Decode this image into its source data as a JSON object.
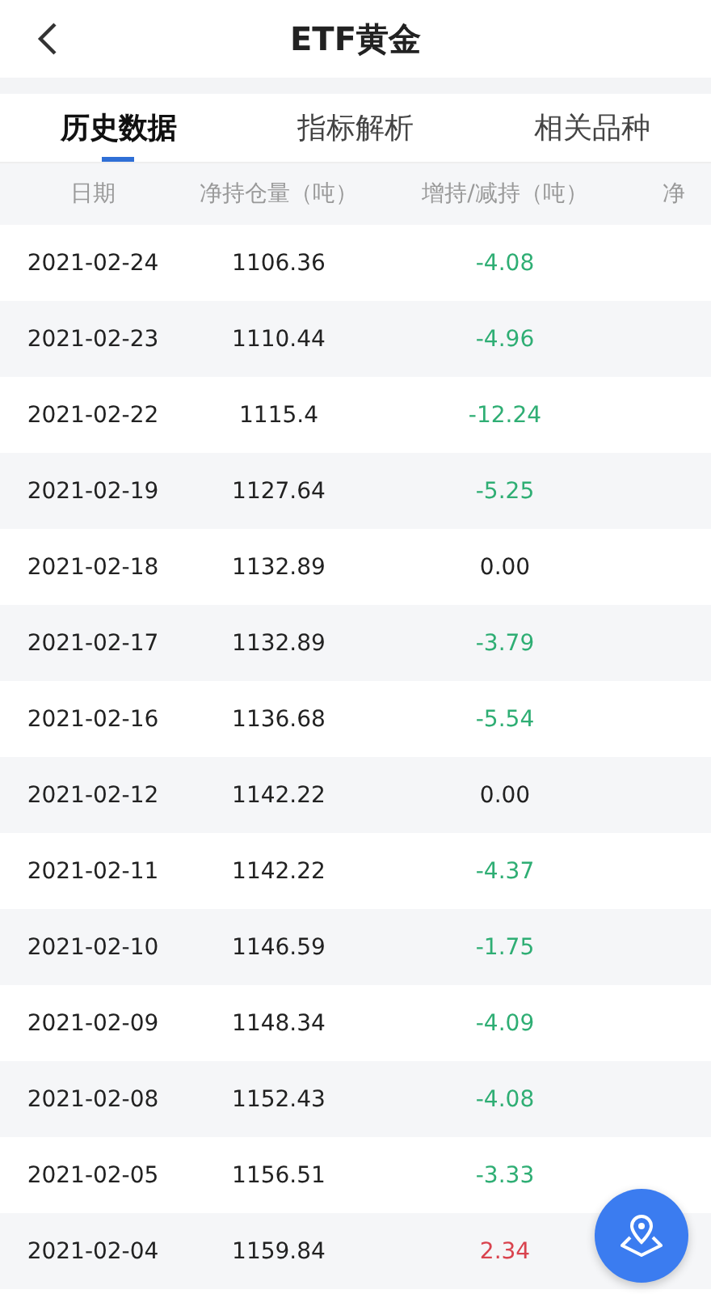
{
  "header": {
    "title": "ETF黄金"
  },
  "tabs": [
    {
      "label": "历史数据",
      "selected": true
    },
    {
      "label": "指标解析",
      "selected": false
    },
    {
      "label": "相关品种",
      "selected": false
    }
  ],
  "table": {
    "columns": [
      "日期",
      "净持仓量（吨）",
      "增持/减持（吨）",
      "净"
    ],
    "rows": [
      {
        "date": "2021-02-24",
        "holding": "1106.36",
        "change": "-4.08",
        "color": "#2fae74"
      },
      {
        "date": "2021-02-23",
        "holding": "1110.44",
        "change": "-4.96",
        "color": "#2fae74"
      },
      {
        "date": "2021-02-22",
        "holding": "1115.4",
        "change": "-12.24",
        "color": "#2fae74"
      },
      {
        "date": "2021-02-19",
        "holding": "1127.64",
        "change": "-5.25",
        "color": "#2fae74"
      },
      {
        "date": "2021-02-18",
        "holding": "1132.89",
        "change": "0.00",
        "color": "#222222"
      },
      {
        "date": "2021-02-17",
        "holding": "1132.89",
        "change": "-3.79",
        "color": "#2fae74"
      },
      {
        "date": "2021-02-16",
        "holding": "1136.68",
        "change": "-5.54",
        "color": "#2fae74"
      },
      {
        "date": "2021-02-12",
        "holding": "1142.22",
        "change": "0.00",
        "color": "#222222"
      },
      {
        "date": "2021-02-11",
        "holding": "1142.22",
        "change": "-4.37",
        "color": "#2fae74"
      },
      {
        "date": "2021-02-10",
        "holding": "1146.59",
        "change": "-1.75",
        "color": "#2fae74"
      },
      {
        "date": "2021-02-09",
        "holding": "1148.34",
        "change": "-4.09",
        "color": "#2fae74"
      },
      {
        "date": "2021-02-08",
        "holding": "1152.43",
        "change": "-4.08",
        "color": "#2fae74"
      },
      {
        "date": "2021-02-05",
        "holding": "1156.51",
        "change": "-3.33",
        "color": "#2fae74"
      },
      {
        "date": "2021-02-04",
        "holding": "1159.84",
        "change": "2.34",
        "color": "#d9434e"
      }
    ]
  }
}
